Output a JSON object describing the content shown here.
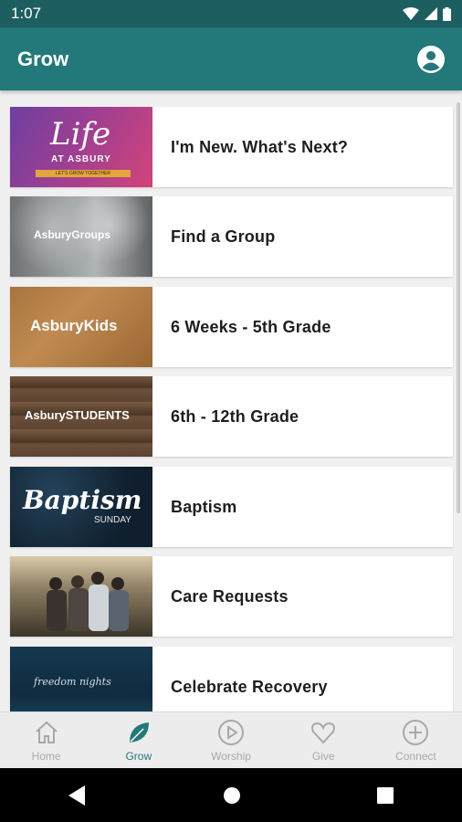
{
  "status_bar": {
    "time": "1:07"
  },
  "app_bar": {
    "title": "Grow"
  },
  "thumbs": {
    "life_script": "Life",
    "life_at": "AT ASBURY",
    "life_tagline": "LET'S GROW TOGETHER",
    "groups": "AsburyGroups",
    "kids": "AsburyKids",
    "students": "AsburySTUDENTS",
    "baptism": "Baptism",
    "baptism_sub": "SUNDAY",
    "recovery": "freedom nights"
  },
  "items": [
    {
      "label": "I'm New. What's Next?"
    },
    {
      "label": "Find a Group"
    },
    {
      "label": "6 Weeks - 5th Grade"
    },
    {
      "label": "6th - 12th Grade"
    },
    {
      "label": "Baptism"
    },
    {
      "label": "Care Requests"
    },
    {
      "label": "Celebrate Recovery"
    }
  ],
  "bottom_nav": [
    {
      "label": "Home",
      "icon": "home-icon"
    },
    {
      "label": "Grow",
      "icon": "leaf-icon",
      "active": true
    },
    {
      "label": "Worship",
      "icon": "play-icon"
    },
    {
      "label": "Give",
      "icon": "heart-icon"
    },
    {
      "label": "Connect",
      "icon": "plus-icon"
    }
  ],
  "colors": {
    "primary": "#23787a",
    "status": "#1d5e60",
    "inactive": "#a8a8a8"
  }
}
